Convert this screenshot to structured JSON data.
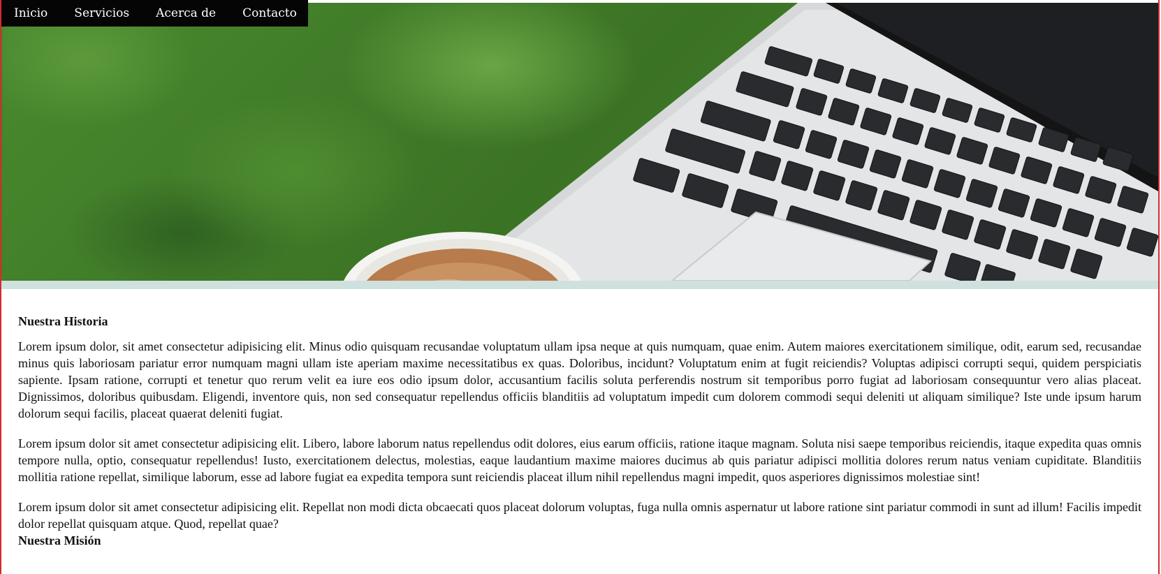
{
  "nav": {
    "items": [
      {
        "label": "Inicio"
      },
      {
        "label": "Servicios"
      },
      {
        "label": "Acerca de"
      },
      {
        "label": "Contacto"
      }
    ]
  },
  "hero": {
    "image": "laptop-and-coffee-on-grass"
  },
  "content": {
    "history_title": "Nuestra Historia",
    "paragraphs": [
      "Lorem ipsum dolor, sit amet consectetur adipisicing elit. Minus odio quisquam recusandae voluptatum ullam ipsa neque at quis numquam, quae enim. Autem maiores exercitationem similique, odit, earum sed, recusandae minus quis laboriosam pariatur error numquam magni ullam iste aperiam maxime necessitatibus ex quas. Doloribus, incidunt? Voluptatum enim at fugit reiciendis? Voluptas adipisci corrupti sequi, quidem perspiciatis sapiente. Ipsam ratione, corrupti et tenetur quo rerum velit ea iure eos odio ipsum dolor, accusantium facilis soluta perferendis nostrum sit temporibus porro fugiat ad laboriosam consequuntur vero alias placeat. Dignissimos, doloribus quibusdam. Eligendi, inventore quis, non sed consequatur repellendus officiis blanditiis ad voluptatum impedit cum dolorem commodi sequi deleniti ut aliquam similique? Iste unde ipsum harum dolorum sequi facilis, placeat quaerat deleniti fugiat.",
      "Lorem ipsum dolor sit amet consectetur adipisicing elit. Libero, labore laborum natus repellendus odit dolores, eius earum officiis, ratione itaque magnam. Soluta nisi saepe temporibus reiciendis, itaque expedita quas omnis tempore nulla, optio, consequatur repellendus! Iusto, exercitationem delectus, molestias, eaque laudantium maxime maiores ducimus ab quis pariatur adipisci mollitia dolores rerum natus veniam cupiditate. Blanditiis mollitia ratione repellat, similique laborum, esse ad labore fugiat ea expedita tempora sunt reiciendis placeat illum nihil repellendus magni impedit, quos asperiores dignissimos molestiae sint!",
      "Lorem ipsum dolor sit amet consectetur adipisicing elit. Repellat non modi dicta obcaecati quos placeat dolorum voluptas, fuga nulla omnis aspernatur ut labore ratione sint pariatur commodi in sunt ad illum! Facilis impedit dolor repellat quisquam atque. Quod, repellat quae?"
    ],
    "mission_title": "Nuestra Misión"
  },
  "colors": {
    "nav_bg": "#050505",
    "frame_border": "#d42b2b",
    "hero_strip": "#cfe1de"
  }
}
